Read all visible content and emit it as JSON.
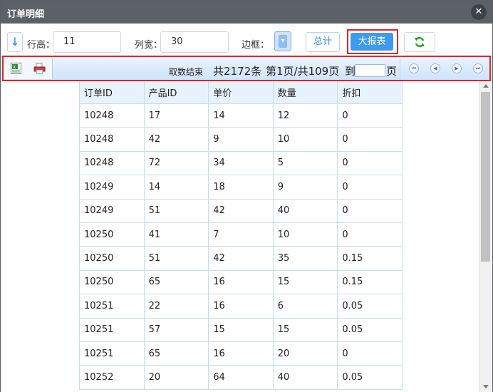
{
  "window": {
    "title": "订单明细",
    "close_label": "✕"
  },
  "toolbar": {
    "sort_icon": "↓",
    "row_height_label": "行高：",
    "row_height_value": "11",
    "col_width_label": "列宽：",
    "col_width_value": "30",
    "border_label": "边框：",
    "border_dropdown_icon": "chevron-down-icon",
    "total_label": "总计",
    "big_report_label": "大报表",
    "refresh_icon": "refresh-icon",
    "highlight_color": "#d9262c"
  },
  "navbar": {
    "export_excel_icon": "excel-icon",
    "print_icon": "print-icon",
    "status": "取数结束",
    "total": "共2172条",
    "page_info": "第1页/共109页",
    "goto_label": "到",
    "goto_value": "",
    "page_unit": "页",
    "pager": [
      "first-page-icon",
      "prev-page-icon",
      "next-page-icon",
      "last-page-icon"
    ]
  },
  "table": {
    "headers": [
      "订单ID",
      "产品ID",
      "单价",
      "数量",
      "折扣"
    ],
    "rows": [
      [
        "10248",
        "17",
        "14",
        "12",
        "0"
      ],
      [
        "10248",
        "42",
        "9",
        "10",
        "0"
      ],
      [
        "10248",
        "72",
        "34",
        "5",
        "0"
      ],
      [
        "10249",
        "14",
        "18",
        "9",
        "0"
      ],
      [
        "10249",
        "51",
        "42",
        "40",
        "0"
      ],
      [
        "10250",
        "41",
        "7",
        "10",
        "0"
      ],
      [
        "10250",
        "51",
        "42",
        "35",
        "0.15"
      ],
      [
        "10250",
        "65",
        "16",
        "15",
        "0.15"
      ],
      [
        "10251",
        "22",
        "16",
        "6",
        "0.05"
      ],
      [
        "10251",
        "57",
        "15",
        "15",
        "0.05"
      ],
      [
        "10251",
        "65",
        "16",
        "20",
        "0"
      ],
      [
        "10252",
        "20",
        "64",
        "40",
        "0.05"
      ]
    ]
  },
  "colors": {
    "accent": "#3d9bee",
    "titlebar": "#5c6167",
    "grid_border": "#c9dced"
  }
}
